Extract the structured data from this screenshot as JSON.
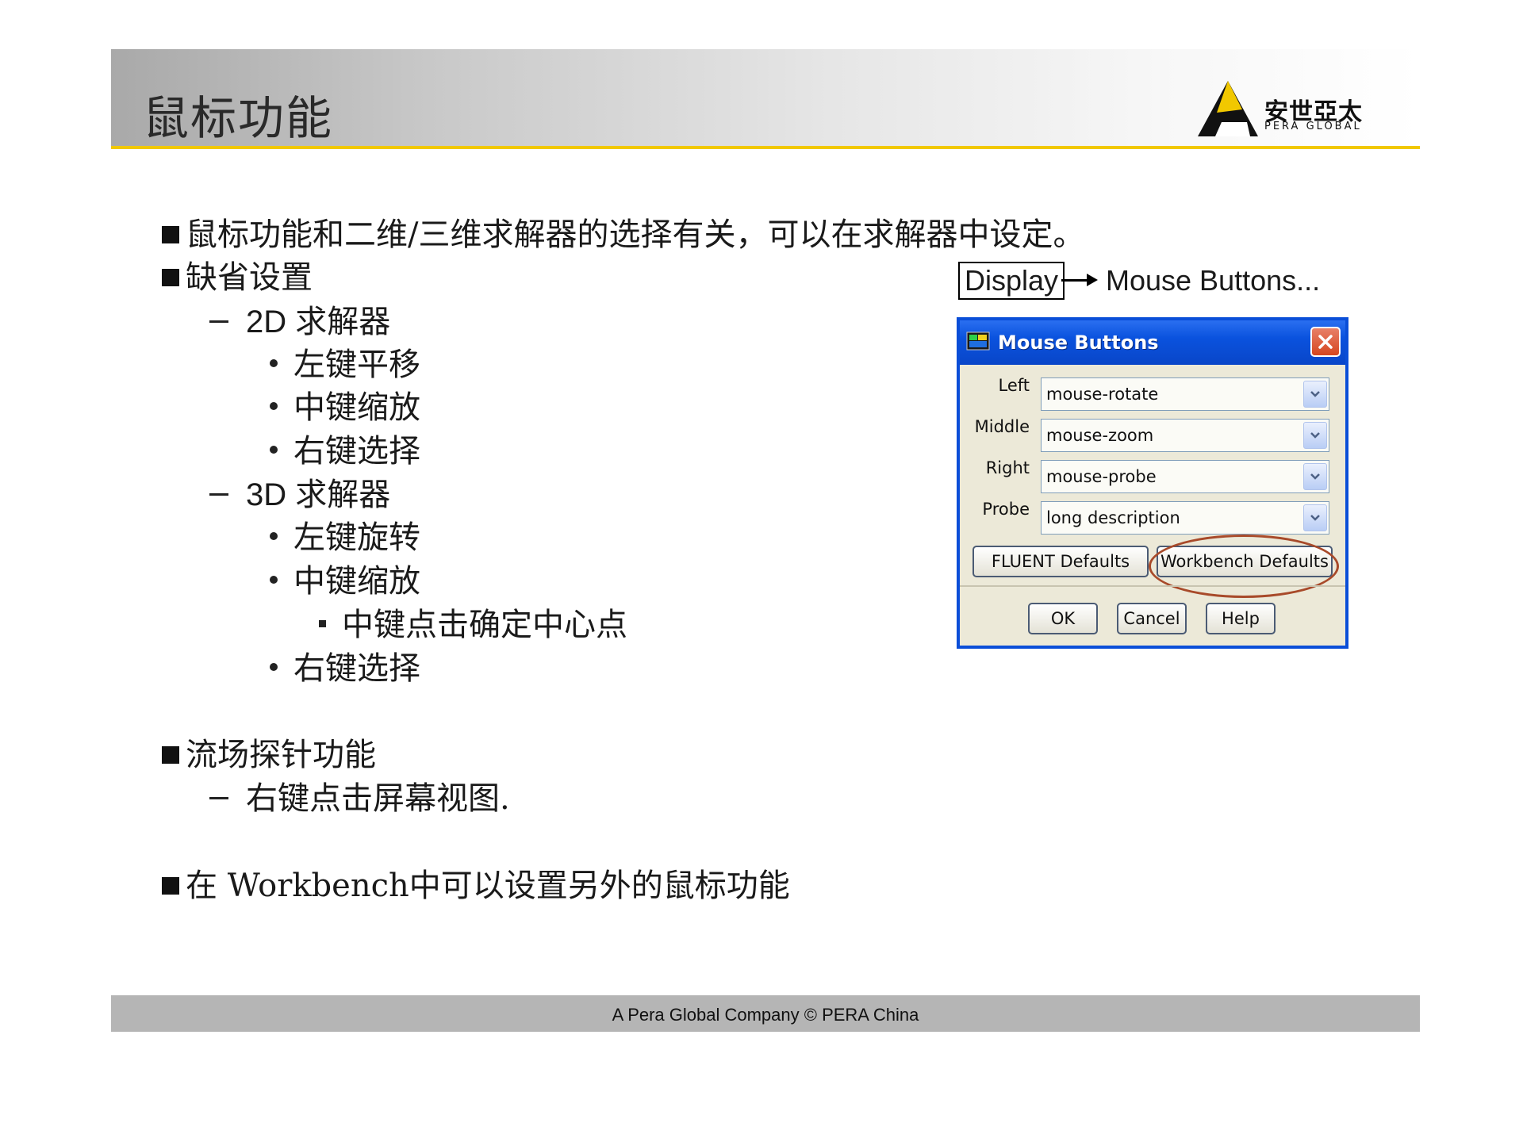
{
  "header": {
    "title": "鼠标功能",
    "logo": {
      "cn": "安世亞太",
      "en": "PERA GLOBAL"
    }
  },
  "content": {
    "bullet1": "鼠标功能和二维/三维求解器的选择有关，可以在求解器中设定。",
    "bullet2": "缺省设置",
    "solver2d": {
      "heading": "2D 求解器",
      "items": [
        "左键平移",
        "中键缩放",
        "右键选择"
      ]
    },
    "solver3d": {
      "heading": "3D 求解器",
      "items": [
        "左键旋转",
        "中键缩放",
        "中键点击确定中心点",
        "右键选择"
      ]
    },
    "bullet3": "流场探针功能",
    "probe_sub": "右键点击屏幕视图.",
    "bullet4": "在 Workbench中可以设置另外的鼠标功能"
  },
  "menu_path": {
    "menu": "Display",
    "target": "Mouse Buttons..."
  },
  "dialog": {
    "title": "Mouse Buttons",
    "rows": [
      {
        "label": "Left",
        "value": "mouse-rotate"
      },
      {
        "label": "Middle",
        "value": "mouse-zoom"
      },
      {
        "label": "Right",
        "value": "mouse-probe"
      },
      {
        "label": "Probe",
        "value": "long description"
      }
    ],
    "fluent_defaults": "FLUENT Defaults",
    "workbench_defaults": "Workbench Defaults",
    "ok": "OK",
    "cancel": "Cancel",
    "help": "Help"
  },
  "footer": {
    "text": "A Pera Global Company ©  PERA China"
  },
  "colors": {
    "accent_yellow": "#f1c800",
    "dialog_blue": "#0a4ed8",
    "highlight_oval": "#a84a2a"
  }
}
